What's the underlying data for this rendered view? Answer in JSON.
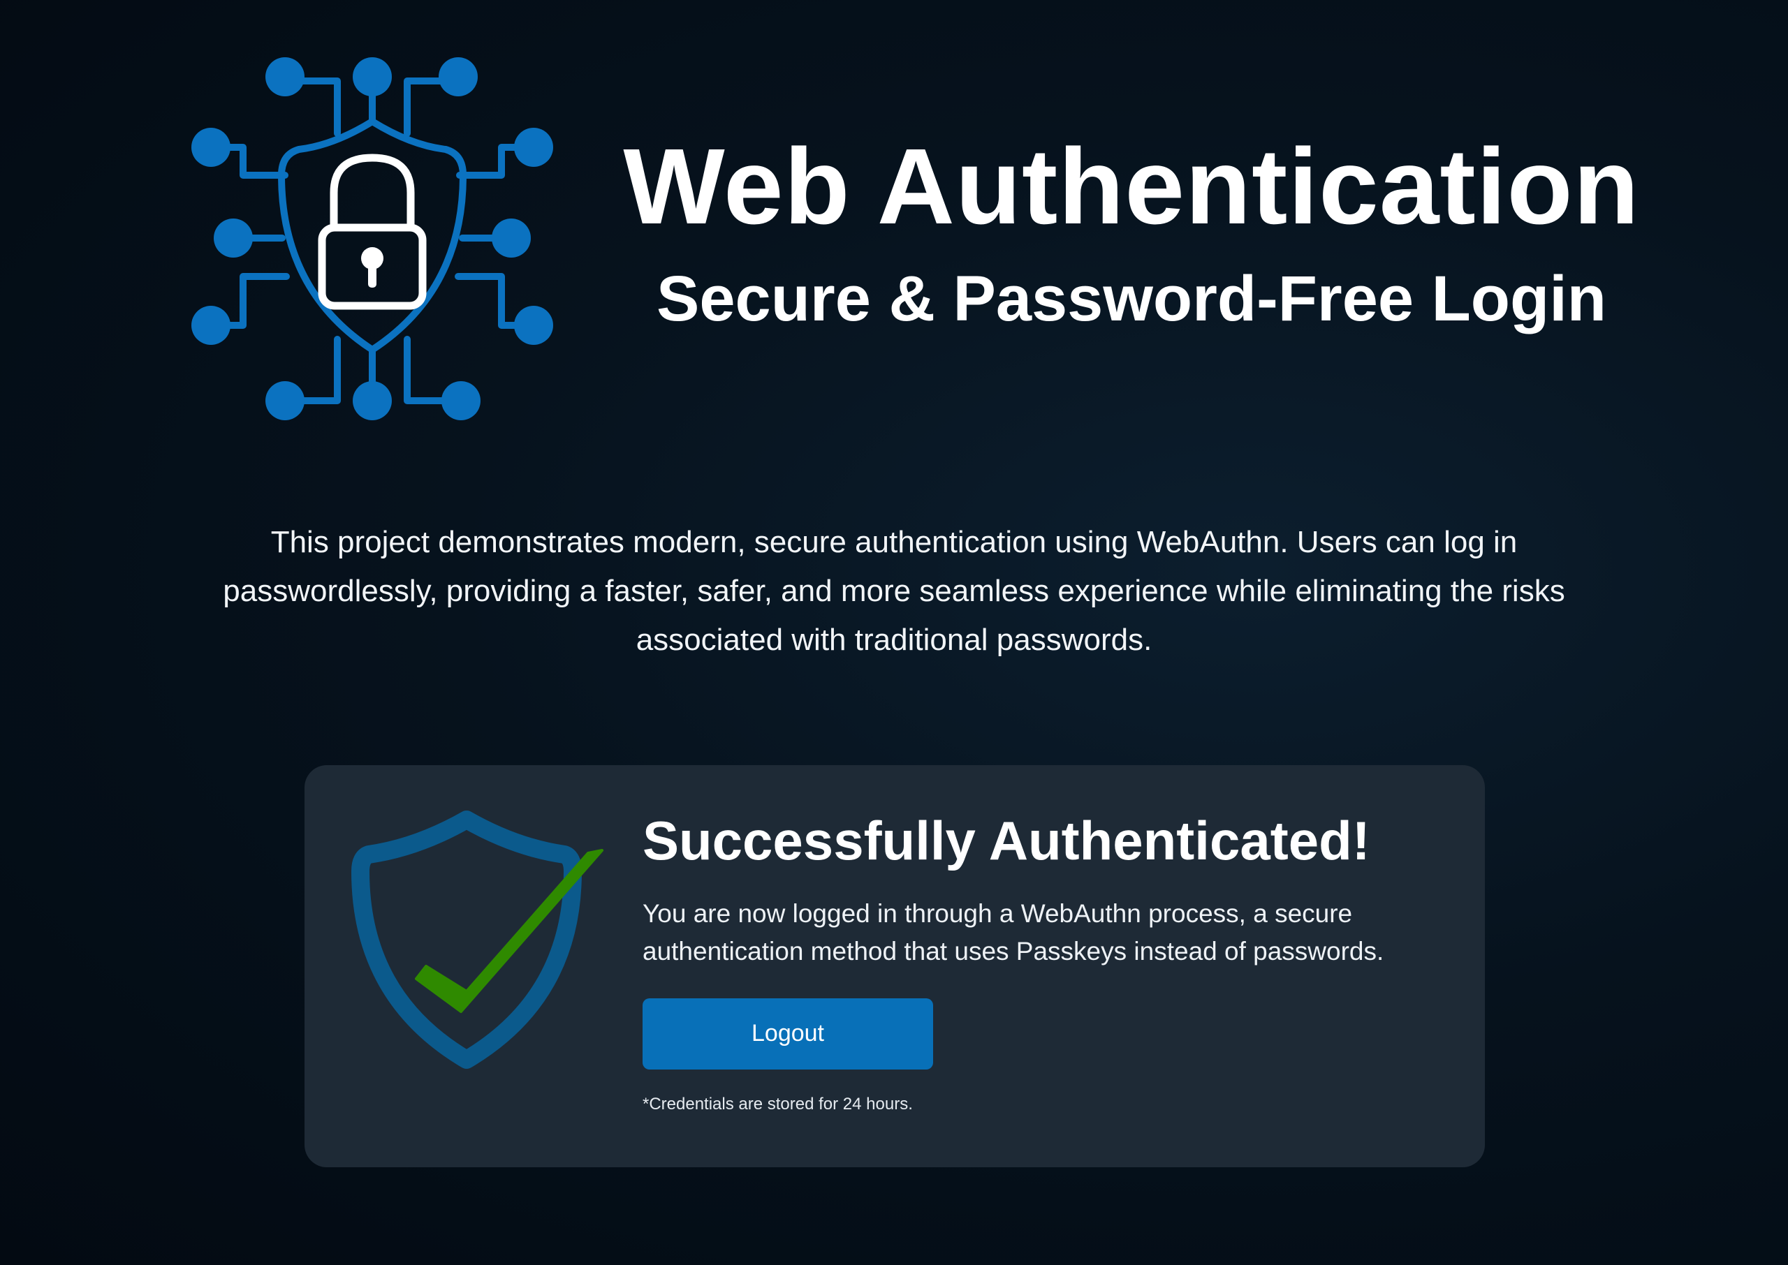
{
  "header": {
    "title": "Web Authentication",
    "subtitle": "Secure & Password-Free Login",
    "logo_icon": "circuit-shield-lock-icon"
  },
  "intro": {
    "text": "This project demonstrates modern, secure authentication using WebAuthn. Users can log in passwordlessly, providing a faster, safer, and more seamless experience while eliminating the risks associated with traditional passwords."
  },
  "status_card": {
    "icon": "shield-check-icon",
    "title": "Successfully Authenticated!",
    "description": "You are now logged in through a WebAuthn process, a secure authentication method that uses Passkeys instead of passwords.",
    "logout_label": "Logout",
    "note": "*Credentials are stored for 24 hours."
  },
  "colors": {
    "accent_blue": "#0870b8",
    "shield_blue": "#0b5a8c",
    "check_green": "#2f8a00",
    "card_background": "#1e2a36",
    "page_background": "#06121d"
  }
}
